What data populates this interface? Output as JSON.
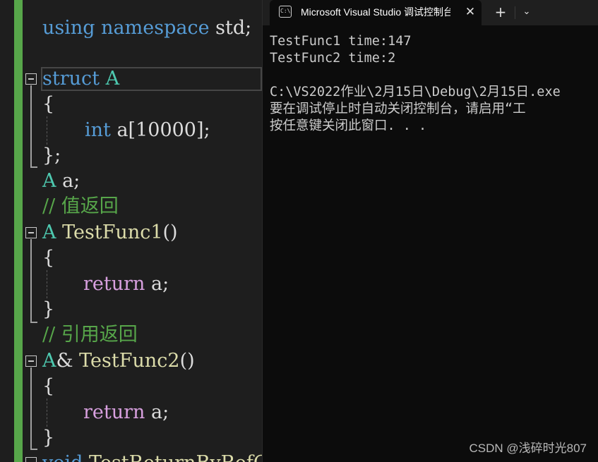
{
  "editor": {
    "lines": {
      "using": {
        "kw1": "using",
        "kw2": "namespace",
        "rest": " std;"
      },
      "struct": {
        "kw": "struct",
        "name": "A"
      },
      "open1": "{",
      "member": {
        "type": "int",
        "rest": " a[10000];"
      },
      "close1": "};",
      "decl": {
        "type": "A",
        "rest": " a;"
      },
      "comment1": "// 值返回",
      "func1": {
        "type": "A",
        "name": "TestFunc1",
        "rest": "()"
      },
      "open2": "{",
      "ret1": {
        "kw": "return",
        "rest": " a;"
      },
      "close2": "}",
      "comment2": "// 引用返回",
      "func2": {
        "type": "A",
        "amp": "&",
        "name": "TestFunc2",
        "rest": "()"
      },
      "open3": "{",
      "ret2": {
        "kw": "return",
        "rest": " a;"
      },
      "close3": "}",
      "partial": {
        "kw": "void",
        "name": "TestReturnByRefO"
      }
    }
  },
  "console": {
    "tab": {
      "icon": "console-app-icon",
      "title": "Microsoft Visual Studio 调试控制台",
      "close_glyph": "✕",
      "new_tab_glyph": "+",
      "dropdown_glyph": "⌄"
    },
    "output": [
      "TestFunc1 time:147",
      "TestFunc2 time:2",
      "",
      "C:\\VS2022作业\\2月15日\\Debug\\2月15日.exe",
      "要在调试停止时自动关闭控制台，请启用“工",
      "按任意键关闭此窗口. . ."
    ]
  },
  "watermark": "CSDN @浅碎时光807",
  "colors": {
    "keyword": "#569cd6",
    "return_keyword": "#d8a0df",
    "type": "#4ec9b0",
    "function": "#dcdcaa",
    "comment": "#57a64a",
    "console_bg": "#0c0c0c",
    "editor_bg": "#1e1e1e"
  }
}
